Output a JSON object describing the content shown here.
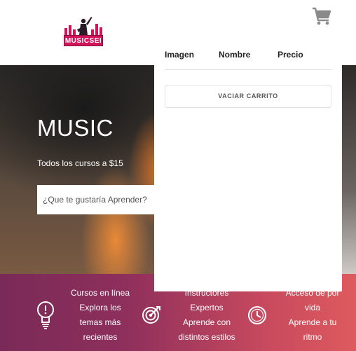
{
  "brand": {
    "logo_text": "MUSICSEI"
  },
  "hero": {
    "title": "MUSIC",
    "subtitle": "Todos los cursos a $15",
    "search_placeholder": "¿Que te gustaría Aprender?"
  },
  "features": [
    {
      "icon": "lightbulb-icon",
      "lines": [
        "Cursos en línea",
        "Explora los",
        "temas más",
        "recientes"
      ]
    },
    {
      "icon": "target-icon",
      "lines": [
        "Instructores",
        "Expertos",
        "Aprende con",
        "distintos estilos"
      ]
    },
    {
      "icon": "clock-icon",
      "lines": [
        "Acceso de por",
        "vida",
        "Aprende a tu",
        "ritmo"
      ]
    }
  ],
  "cart": {
    "icon": "shopping-cart-icon",
    "headers": [
      "Imagen",
      "Nombre",
      "Precio"
    ],
    "empty_button": "VACIAR CARRITO"
  },
  "colors": {
    "accent_pink": "#d4145a",
    "features_gradient_start": "#7a2a58",
    "features_gradient_end": "#de5a5e",
    "cart_icon": "#8a8a8a"
  }
}
